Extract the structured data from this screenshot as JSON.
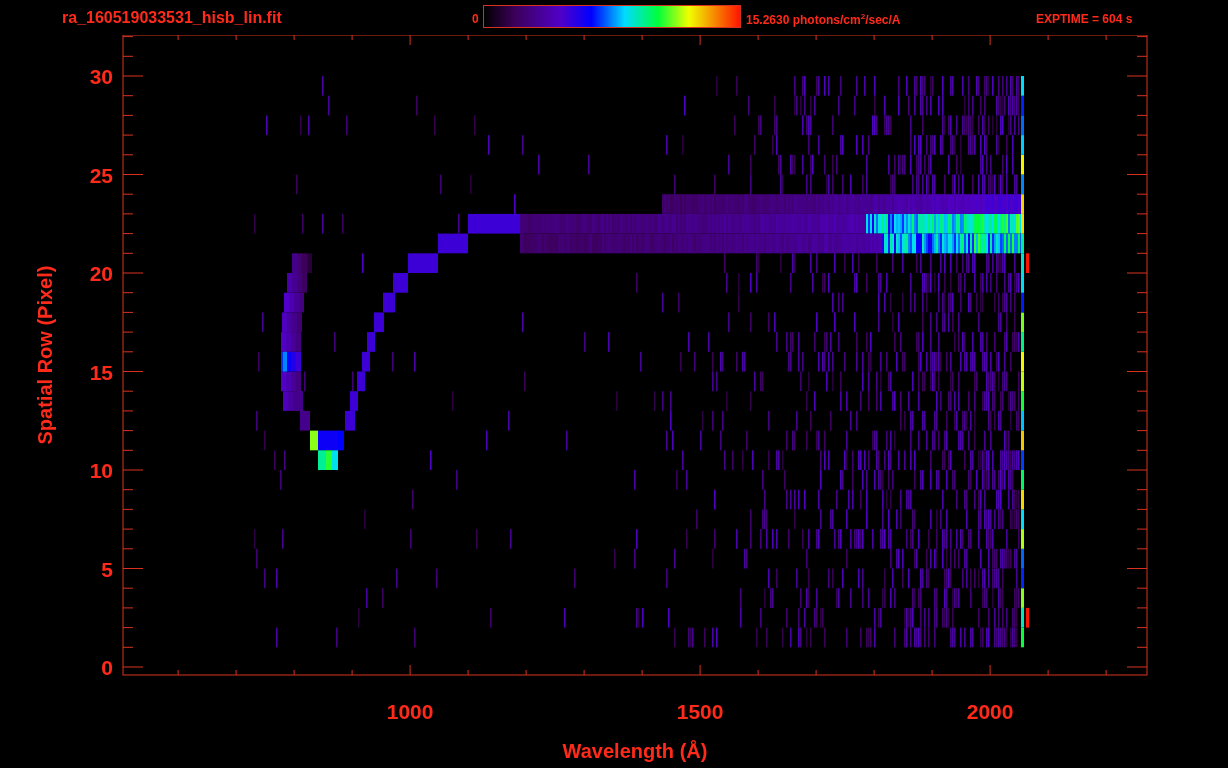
{
  "header": {
    "title": "ra_160519033531_hisb_lin.fit",
    "colorbar": {
      "min_label": "0",
      "max_label": "15.2630 photons/cm$^{2}$/sec/A"
    },
    "exposure": "EXPTIME = 604 s"
  },
  "plot": {
    "xlabel": "Wavelength (Å)",
    "ylabel": "Spatial Row (Pixel)",
    "xticks": [
      "1000",
      "1500",
      "2000"
    ],
    "yticks": [
      "30",
      "25",
      "20",
      "15",
      "10",
      "5",
      "0"
    ]
  }
}
